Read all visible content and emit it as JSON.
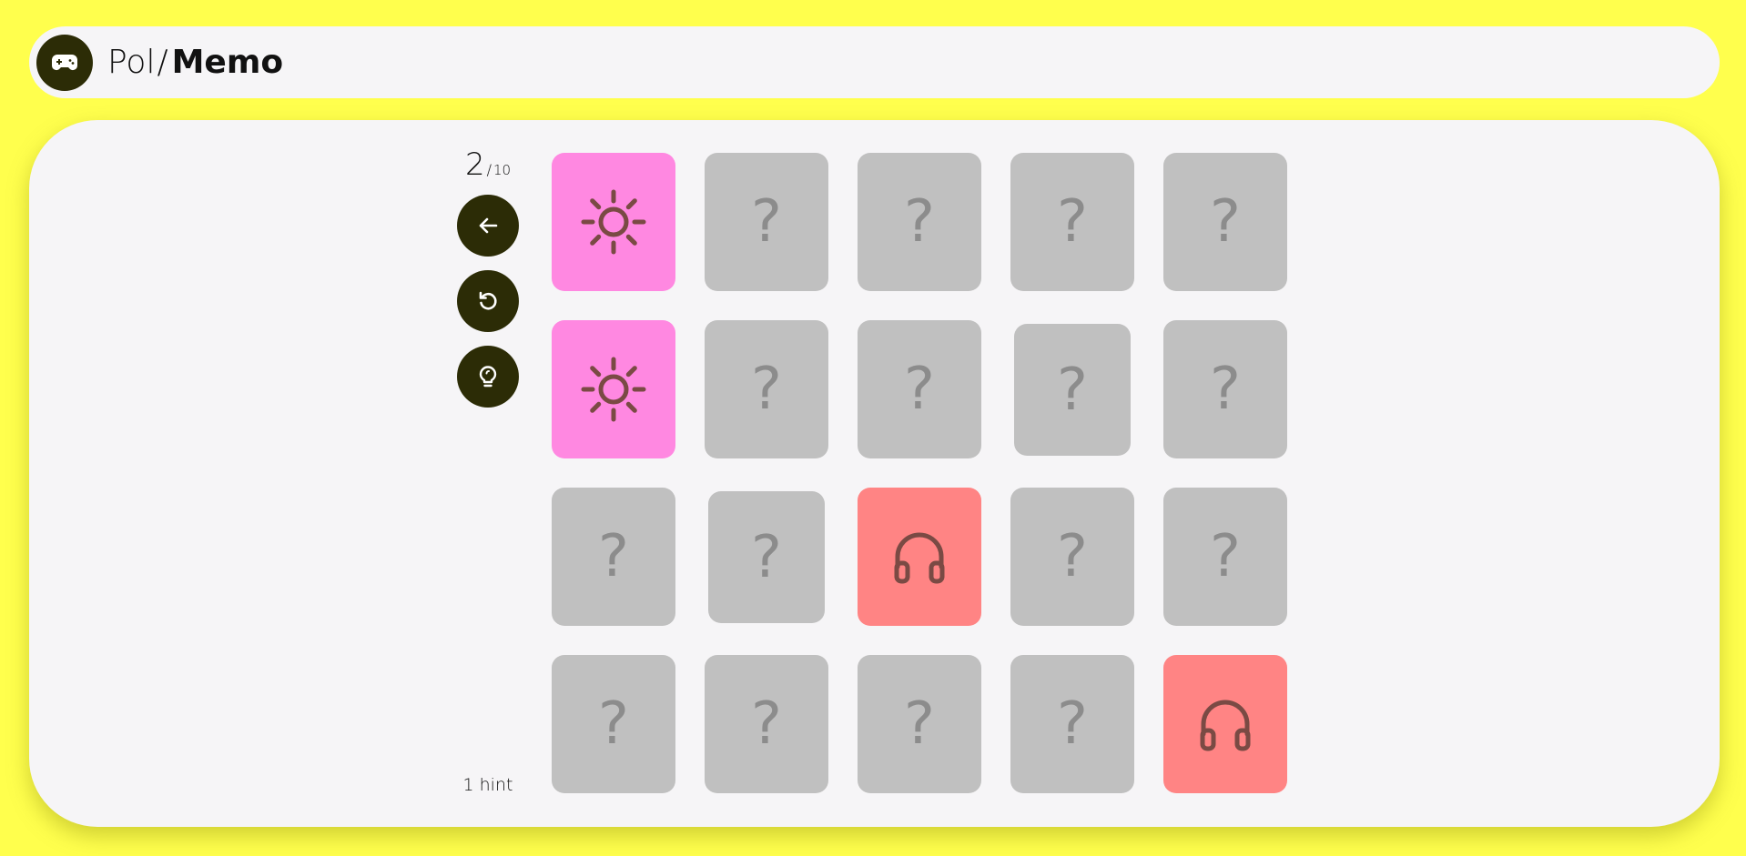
{
  "app": {
    "brand_prefix": "Pol",
    "brand_separator": "/",
    "brand_name": "Memo",
    "logo_icon": "gamepad-icon"
  },
  "game": {
    "found_pairs": "2",
    "separator": "/",
    "total_pairs": "10",
    "hints_label": "1 hint",
    "controls": [
      {
        "name": "back-button",
        "icon": "arrow-left-icon"
      },
      {
        "name": "restart-button",
        "icon": "restart-icon"
      },
      {
        "name": "hint-button",
        "icon": "lightbulb-icon"
      }
    ],
    "hidden_symbol": "?",
    "colors": {
      "background": "#ffff4d",
      "panel": "#f6f5f7",
      "dark": "#2c2c06",
      "card_hidden": "#c0c0c0",
      "card_sun": "#ff88e1",
      "card_headphones": "#ff8484",
      "icon_stroke": "#7a4a44"
    },
    "cards": [
      [
        {
          "state": "revealed",
          "icon": "sun-icon"
        },
        {
          "state": "hidden"
        },
        {
          "state": "hidden"
        },
        {
          "state": "hidden"
        },
        {
          "state": "hidden"
        }
      ],
      [
        {
          "state": "revealed",
          "icon": "sun-icon"
        },
        {
          "state": "hidden"
        },
        {
          "state": "hidden"
        },
        {
          "state": "hidden"
        },
        {
          "state": "hidden"
        }
      ],
      [
        {
          "state": "hidden"
        },
        {
          "state": "hidden"
        },
        {
          "state": "revealed",
          "icon": "headphones-icon"
        },
        {
          "state": "hidden"
        },
        {
          "state": "hidden"
        }
      ],
      [
        {
          "state": "hidden"
        },
        {
          "state": "hidden"
        },
        {
          "state": "hidden"
        },
        {
          "state": "hidden"
        },
        {
          "state": "revealed",
          "icon": "headphones-icon"
        }
      ]
    ]
  }
}
